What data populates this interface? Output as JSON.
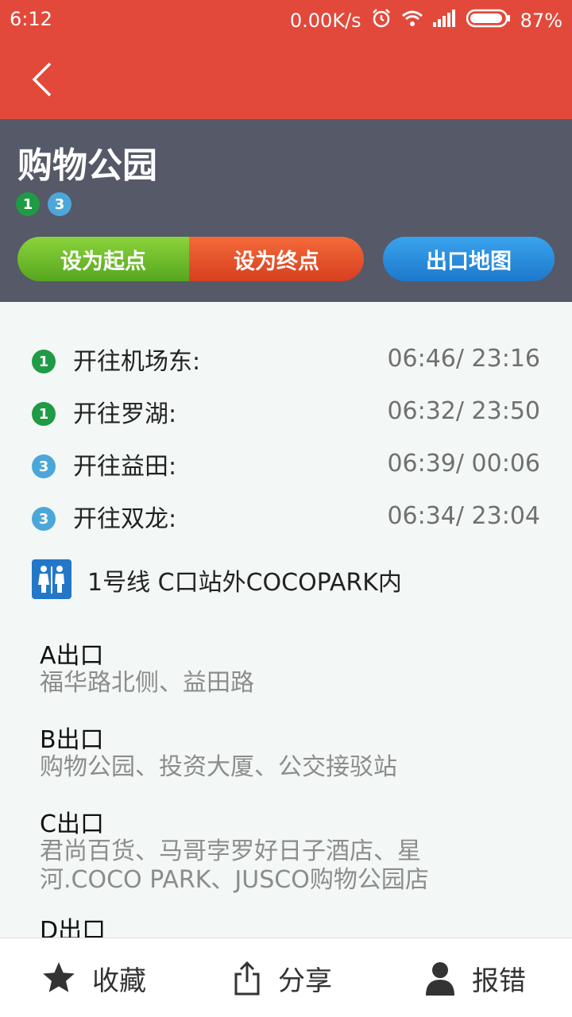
{
  "status_bar": {
    "time": "6:12",
    "net_speed": "0.00K/s",
    "battery": "87%",
    "icons": [
      "alarm-icon",
      "wifi-icon",
      "signal-icon",
      "battery-icon"
    ]
  },
  "header": {
    "back_icon": "chevron-left-icon",
    "station_name": "购物公园",
    "lines": [
      "1",
      "3"
    ],
    "buttons": {
      "set_start": "设为起点",
      "set_end": "设为终点",
      "exit_map": "出口地图"
    }
  },
  "schedule": [
    {
      "line": "1",
      "direction": "开往机场东:",
      "times": "06:46/ 23:16"
    },
    {
      "line": "1",
      "direction": "开往罗湖:",
      "times": "06:32/ 23:50"
    },
    {
      "line": "3",
      "direction": "开往益田:",
      "times": "06:39/ 00:06"
    },
    {
      "line": "3",
      "direction": "开往双龙:",
      "times": "06:34/ 23:04"
    }
  ],
  "toilet": {
    "icon": "restroom-icon",
    "text": "1号线  C口站外COCOPARK内"
  },
  "exits": [
    {
      "name": "A出口",
      "desc": "福华路北侧、益田路"
    },
    {
      "name": "B出口",
      "desc": "购物公园、投资大厦、公交接驳站"
    },
    {
      "name": "C出口",
      "desc": "君尚百货、马哥孛罗好日子酒店、星河.COCO PARK、JUSCO购物公园店"
    },
    {
      "name": "D出口",
      "desc": ""
    }
  ],
  "bottom_bar": {
    "favorite": "收藏",
    "share": "分享",
    "report": "报错"
  },
  "colors": {
    "appbar": "#e2493a",
    "hero": "#555968",
    "line1": "#1f9a45",
    "line3": "#4ba7d9",
    "start_btn": "#6dbd2b",
    "end_btn": "#e5522d",
    "map_btn": "#2a8de0"
  }
}
